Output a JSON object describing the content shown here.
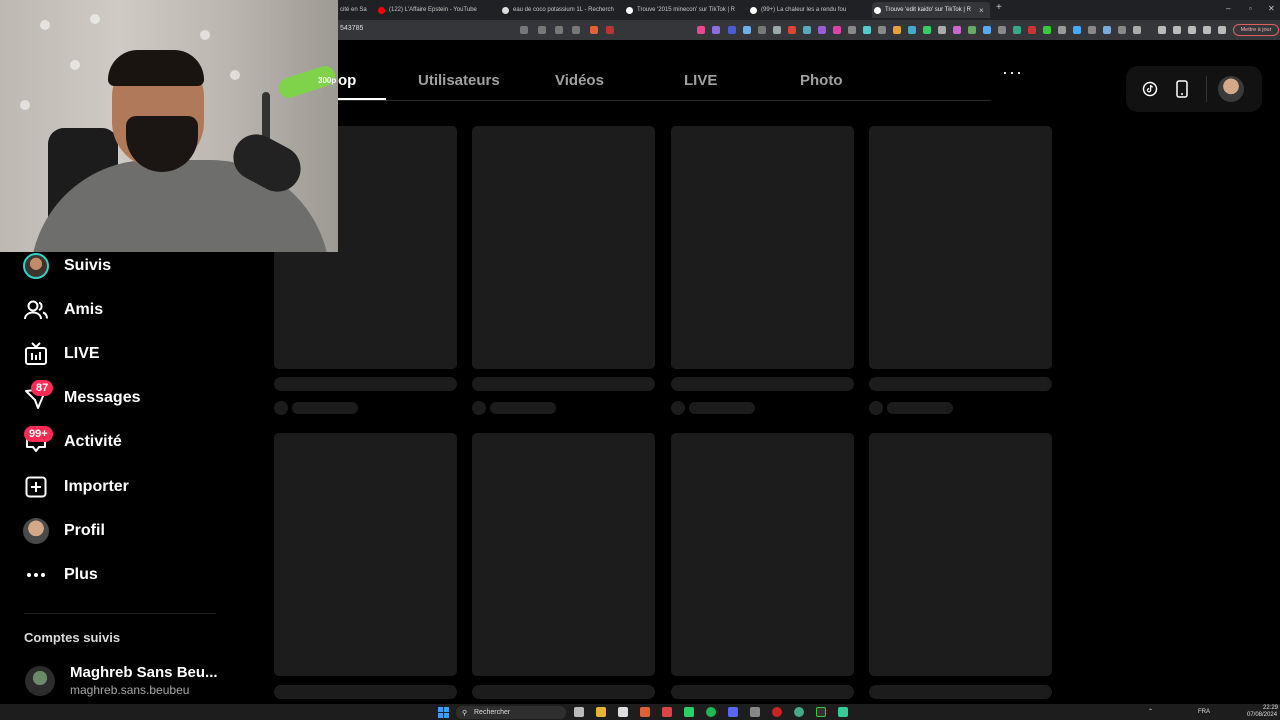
{
  "browser": {
    "tabs": [
      {
        "label": "cité en Sa",
        "active": false
      },
      {
        "label": "(122) L'Affaire Epstein - YouTube",
        "active": false
      },
      {
        "label": "eau de coco potassium 1L - Recherch",
        "active": false
      },
      {
        "label": "Trouve '2015 minecon' sur TikTok | R",
        "active": false
      },
      {
        "label": "(99+) La chaleur les a rendu fou",
        "active": false
      },
      {
        "label": "Trouve 'edit kaido' sur TikTok | R",
        "active": true
      }
    ],
    "url_fragment": "543785",
    "update_button": "Mettre à jour",
    "new_tab": "+",
    "close_tab": "×"
  },
  "tiktok": {
    "tabs": [
      "op",
      "Utilisateurs",
      "Vidéos",
      "LIVE",
      "Photo"
    ],
    "more": "···",
    "sidebar": {
      "items": [
        {
          "label": "Suivis",
          "icon": "following-avatar-icon"
        },
        {
          "label": "Amis",
          "icon": "friends-icon"
        },
        {
          "label": "LIVE",
          "icon": "live-tv-icon"
        },
        {
          "label": "Messages",
          "icon": "messages-icon",
          "badge": "87"
        },
        {
          "label": "Activité",
          "icon": "activity-icon",
          "badge": "99+"
        },
        {
          "label": "Importer",
          "icon": "upload-plus-icon"
        },
        {
          "label": "Profil",
          "icon": "profile-avatar-icon"
        },
        {
          "label": "Plus",
          "icon": "more-dots-icon"
        }
      ],
      "followed_title": "Comptes suivis",
      "followed": [
        {
          "name": "Maghreb Sans Beu...",
          "handle": "maghreb.sans.beubeu"
        }
      ]
    }
  },
  "webcam_overlay": {
    "clip_text": "300p"
  },
  "taskbar": {
    "search_label": "Rechercher",
    "lang": "FRA",
    "time": "22:29",
    "date": "07/08/2024"
  },
  "colors": {
    "accent_pink": "#fe2c55",
    "accent_teal": "#2fd3c8",
    "skeleton": "#1c1c1c",
    "background": "#000000"
  }
}
